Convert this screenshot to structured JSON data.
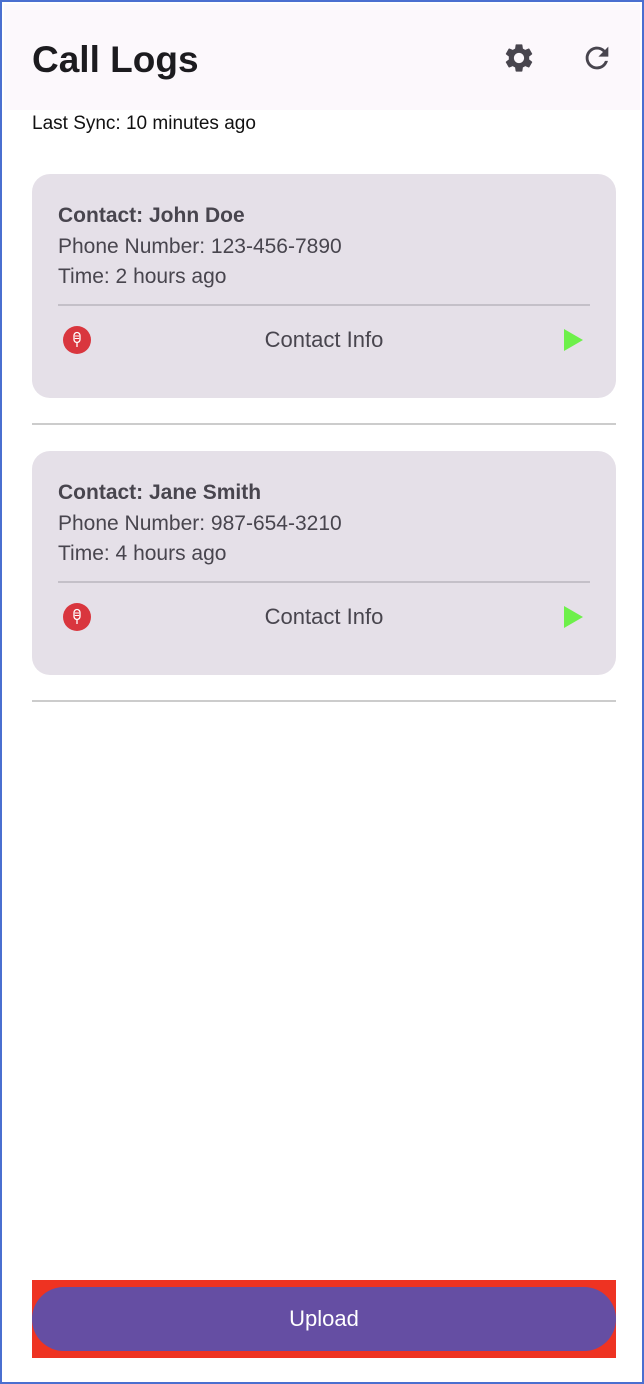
{
  "header": {
    "title": "Call Logs",
    "settings_icon": "gear-icon",
    "refresh_icon": "refresh-icon"
  },
  "sync": {
    "text": "Last Sync: 10 minutes ago"
  },
  "calls": [
    {
      "contact": "Contact: John Doe",
      "phone": "Phone Number: 123-456-7890",
      "time": "Time: 2 hours ago",
      "info_label": "Contact Info",
      "record_icon": "microphone-icon",
      "play_icon": "play-icon"
    },
    {
      "contact": "Contact: Jane Smith",
      "phone": "Phone Number: 987-654-3210",
      "time": "Time: 4 hours ago",
      "info_label": "Contact Info",
      "record_icon": "microphone-icon",
      "play_icon": "play-icon"
    }
  ],
  "footer": {
    "upload_label": "Upload"
  },
  "colors": {
    "accent": "#654ea3",
    "card_bg": "#e5e0e8",
    "record_red": "#d9363e",
    "play_green": "#6df04a",
    "upload_highlight": "#ee3322"
  }
}
